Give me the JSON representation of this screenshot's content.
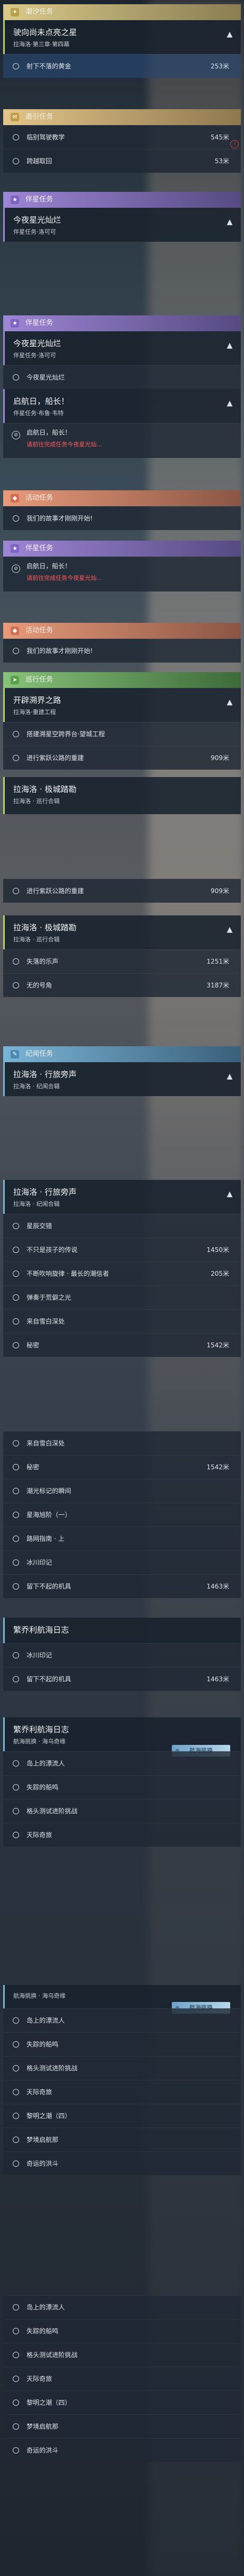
{
  "daily": {
    "header": "潮汐任务",
    "card_title": "驶向尚未点亮之星",
    "card_sub": "拉海洛·第三章·第四幕",
    "item_label": "射下不落的黄金",
    "item_value": "253米"
  },
  "side": {
    "header": "邀引任务",
    "items": [
      {
        "label": "临别驾驶教学",
        "value": "545米"
      },
      {
        "label": "跨越取回",
        "value": "53米"
      }
    ]
  },
  "companion1": {
    "header": "伴星任务",
    "card_title": "今夜星光灿烂",
    "card_sub": "伴星任务·洛可可"
  },
  "companion2": {
    "header": "伴星任务",
    "card_title": "今夜星光灿烂",
    "card_sub": "伴星任务·洛可可",
    "item": "今夜星光灿烂",
    "card2_title": "启航日，船长！",
    "card2_sub": "伴星任务·布鲁·韦特",
    "lock_title": "启航日，船长！",
    "lock_warn": "请前往完成任务今夜星光灿..."
  },
  "activity1": {
    "header": "活动任务",
    "item": "我们的故事才刚刚开始!"
  },
  "activity2": {
    "header": "伴星任务",
    "card_title": "启航日，船长！",
    "lock_warn": "请前往完成任务今夜星光灿..."
  },
  "activity3": {
    "header": "活动任务",
    "item": "我们的故事才刚刚开始!"
  },
  "wander": {
    "header": "巡行任务",
    "card_title": "开辟溯界之路",
    "card_sub": "拉海洛·重建工程",
    "items": [
      {
        "label": "搭建溯星空跨界台·望城工程",
        "value": ""
      },
      {
        "label": "进行紫跃公路的重建",
        "value": "909米"
      }
    ]
  },
  "wander2": {
    "card_title": "拉海洛 · 极城踏勘",
    "card_sub": "拉海洛 · 巡行合辑",
    "item": "进行紫跃公路的重建",
    "item_value": "909米"
  },
  "wander3": {
    "card_title": "拉海洛 · 极城踏勘",
    "card_sub": "拉海洛 · 巡行合辑",
    "items": [
      {
        "label": "失落的乐声",
        "value": "1251米"
      },
      {
        "label": "无的号角",
        "value": "3187米"
      }
    ]
  },
  "epic": {
    "header": "纪闻任务",
    "card_title": "拉海洛 · 行旅旁声",
    "card_sub": "拉海洛 · 纪闻合辑"
  },
  "epic2": {
    "card_title": "拉海洛 · 行旅旁声",
    "card_sub": "拉海洛 · 纪闻合辑",
    "items": [
      {
        "label": "星辰交错",
        "value": ""
      },
      {
        "label": "不只是孩子的传说",
        "value": "1450米"
      },
      {
        "label": "不断吹响旋律 · 最长的潮信者",
        "value": "205米"
      },
      {
        "label": "弹奏于荒僻之光",
        "value": ""
      },
      {
        "label": "来自雪白深处",
        "value": ""
      },
      {
        "label": "秘密",
        "value": "1542米"
      }
    ]
  },
  "epic3": {
    "items": [
      {
        "label": "来自雪白深处",
        "value": ""
      },
      {
        "label": "秘密",
        "value": "1542米"
      },
      {
        "label": "潮光标记的瞬间",
        "value": ""
      },
      {
        "label": "星海旭阶（一）",
        "value": ""
      },
      {
        "label": "路网指南 · 上",
        "value": ""
      },
      {
        "label": "冰川印记",
        "value": ""
      },
      {
        "label": "留下不起的机具",
        "value": "1463米"
      }
    ]
  },
  "voyage": {
    "card_title": "繁乔利航海日志",
    "items": [
      {
        "label": "冰川印记",
        "value": ""
      },
      {
        "label": "留下不起的机具",
        "value": "1463米"
      }
    ]
  },
  "voyage2": {
    "card_title": "繁乔利航海日志",
    "card_sub": "航海挑换 · 海乌奇缘",
    "badge": "航海挑换",
    "items": [
      "岛上的漂流人",
      "失踪的船鸣",
      "格头测试进阶挑战",
      "天际奇旅"
    ]
  },
  "voyage3": {
    "card_sub": "航海挑换 · 海乌奇缘",
    "badge": "航海挑换",
    "items": [
      "岛上的漂流人",
      "失踪的船鸣",
      "格头测试进阶挑战",
      "天际奇旅",
      "黎明之潮（四）",
      "梦境启航那",
      "奇运的洪斗"
    ]
  },
  "voyage4": {
    "items": [
      "岛上的漂流人",
      "失踪的船鸣",
      "格头测试进阶挑战",
      "天际奇旅",
      "黎明之潮（四）",
      "梦境启航那",
      "奇运的洪斗"
    ]
  },
  "colors": {
    "accent": "#b6d36a",
    "warn": "#ff5a5a",
    "badge": "#8fbfe0"
  }
}
